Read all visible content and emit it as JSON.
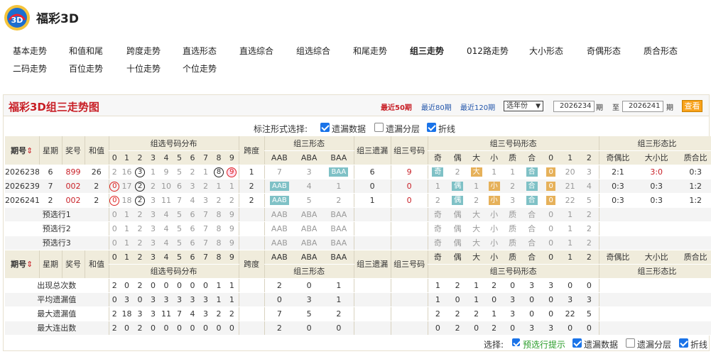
{
  "site": {
    "title": "福彩3D"
  },
  "nav": {
    "items": [
      "基本走势",
      "和值和尾",
      "跨度走势",
      "直选形态",
      "直选综合",
      "组选综合",
      "和尾走势",
      "组三走势",
      "012路走势",
      "大小形态",
      "奇偶形态",
      "质合形态",
      "二码走势",
      "百位走势",
      "十位走势",
      "个位走势"
    ],
    "active": "组三走势"
  },
  "panel": {
    "title": "福彩3D组三走势图",
    "ranges": [
      "最近50期",
      "最近80期",
      "最近120期"
    ],
    "year_select": "选年份",
    "from_issue": "2026234",
    "to_issue": "2026241",
    "issue_unit": "期",
    "to_label": "至",
    "query_button": "查看"
  },
  "options": {
    "label": "标注形式选择:",
    "items": [
      {
        "label": "遗漏数据",
        "checked": true
      },
      {
        "label": "遗漏分层",
        "checked": false
      },
      {
        "label": "折线",
        "checked": true
      }
    ]
  },
  "table": {
    "headers": {
      "issue": "期号",
      "week": "星期",
      "prize": "奖号",
      "sum": "和值",
      "dist": "组选号码分布",
      "span": "跨度",
      "form": "组三形态",
      "miss": "组三遗漏",
      "code": "组三号码",
      "codeform": "组三号码形态",
      "ratio": "组三形态比",
      "digits": [
        "0",
        "1",
        "2",
        "3",
        "4",
        "5",
        "6",
        "7",
        "8",
        "9"
      ],
      "forms": [
        "AAB",
        "ABA",
        "BAA"
      ],
      "cf": [
        "奇",
        "偶",
        "大",
        "小",
        "质",
        "合",
        "0",
        "1",
        "2"
      ],
      "ratios": [
        "奇偶比",
        "大小比",
        "质合比"
      ]
    },
    "rows": [
      {
        "issue": "2026238",
        "week": "6",
        "prize": "899",
        "sum": "26",
        "dist": [
          "2",
          "16",
          "3",
          "1",
          "9",
          "5",
          "2",
          "1",
          "8",
          "9"
        ],
        "span": "1",
        "forms": [
          "7",
          "3",
          "BAA"
        ],
        "miss": "6",
        "code": "9",
        "cf": [
          "奇",
          "2",
          "大",
          "1",
          "1",
          "合",
          "0",
          "20",
          "3"
        ],
        "ratios": [
          "2:1",
          "3:0",
          "0:3"
        ]
      },
      {
        "issue": "2026239",
        "week": "7",
        "prize": "002",
        "sum": "2",
        "dist": [
          "0",
          "17",
          "2",
          "2",
          "10",
          "6",
          "3",
          "2",
          "1",
          "1"
        ],
        "span": "2",
        "forms": [
          "AAB",
          "4",
          "1"
        ],
        "miss": "0",
        "code": "0",
        "cf": [
          "1",
          "偶",
          "1",
          "小",
          "2",
          "合",
          "0",
          "21",
          "4"
        ],
        "ratios": [
          "0:3",
          "0:3",
          "1:2"
        ]
      },
      {
        "issue": "2026241",
        "week": "2",
        "prize": "002",
        "sum": "2",
        "dist": [
          "0",
          "18",
          "2",
          "3",
          "11",
          "7",
          "4",
          "3",
          "2",
          "2"
        ],
        "span": "2",
        "forms": [
          "AAB",
          "5",
          "2"
        ],
        "miss": "1",
        "code": "0",
        "cf": [
          "2",
          "偶",
          "2",
          "小",
          "3",
          "合",
          "0",
          "22",
          "5"
        ],
        "ratios": [
          "0:3",
          "0:3",
          "1:2"
        ]
      }
    ],
    "preselect": {
      "labels": [
        "预选行1",
        "预选行2",
        "预选行3"
      ],
      "digits": [
        "0",
        "1",
        "2",
        "3",
        "4",
        "5",
        "6",
        "7",
        "8",
        "9"
      ],
      "forms": [
        "AAB",
        "ABA",
        "BAA"
      ],
      "cf": [
        "奇",
        "偶",
        "大",
        "小",
        "质",
        "合",
        "0",
        "1",
        "2"
      ]
    },
    "stats": [
      {
        "label": "出现总次数",
        "dist": [
          "2",
          "0",
          "2",
          "0",
          "0",
          "0",
          "0",
          "0",
          "1",
          "1"
        ],
        "forms": [
          "2",
          "0",
          "1"
        ],
        "cf": [
          "1",
          "2",
          "1",
          "2",
          "0",
          "3",
          "3",
          "0",
          "0"
        ]
      },
      {
        "label": "平均遗漏值",
        "dist": [
          "0",
          "3",
          "0",
          "3",
          "3",
          "3",
          "3",
          "3",
          "1",
          "1"
        ],
        "forms": [
          "0",
          "3",
          "1"
        ],
        "cf": [
          "1",
          "0",
          "1",
          "0",
          "3",
          "0",
          "0",
          "3",
          "3"
        ]
      },
      {
        "label": "最大遗漏值",
        "dist": [
          "2",
          "18",
          "3",
          "3",
          "11",
          "7",
          "4",
          "3",
          "2",
          "2"
        ],
        "forms": [
          "7",
          "5",
          "2"
        ],
        "cf": [
          "2",
          "2",
          "2",
          "1",
          "3",
          "0",
          "0",
          "22",
          "5"
        ]
      },
      {
        "label": "最大连出数",
        "dist": [
          "2",
          "0",
          "2",
          "0",
          "0",
          "0",
          "0",
          "0",
          "0",
          "0"
        ],
        "forms": [
          "2",
          "0",
          "0"
        ],
        "cf": [
          "0",
          "2",
          "0",
          "2",
          "0",
          "3",
          "3",
          "0",
          "0"
        ]
      }
    ]
  },
  "bottom": {
    "label": "选择:",
    "items": [
      {
        "label": "预选行提示",
        "checked": true
      },
      {
        "label": "遗漏数据",
        "checked": true
      },
      {
        "label": "遗漏分层",
        "checked": false
      },
      {
        "label": "折线",
        "checked": true
      }
    ]
  },
  "colors": {
    "red": "#c81f26",
    "blue_tag": "#7fc1c6",
    "gold_tag": "#e6b15a",
    "header_bg": "#f0ecdc",
    "link": "#2255aa",
    "button": "#f9a21b"
  }
}
